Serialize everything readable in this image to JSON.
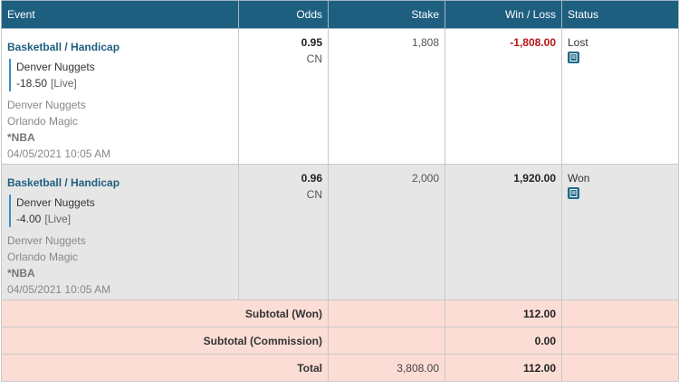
{
  "header": {
    "event": "Event",
    "odds": "Odds",
    "stake": "Stake",
    "winloss": "Win / Loss",
    "status": "Status"
  },
  "bets": [
    {
      "title": "Basketball / Handicap",
      "selection": "Denver Nuggets",
      "line": "-18.50",
      "live": "[Live]",
      "home": "Denver Nuggets",
      "away": "Orlando Magic",
      "league": "*NBA",
      "datetime": "04/05/2021 10:05 AM",
      "odds": "0.95",
      "odds_type": "CN",
      "stake": "1,808",
      "winloss": "-1,808.00",
      "status": "Lost",
      "status_icon": "receipt-icon"
    },
    {
      "title": "Basketball / Handicap",
      "selection": "Denver Nuggets",
      "line": "-4.00",
      "live": "[Live]",
      "home": "Denver Nuggets",
      "away": "Orlando Magic",
      "league": "*NBA",
      "datetime": "04/05/2021 10:05 AM",
      "odds": "0.96",
      "odds_type": "CN",
      "stake": "2,000",
      "winloss": "1,920.00",
      "status": "Won",
      "status_icon": "receipt-icon"
    }
  ],
  "summary": {
    "subtotal_won_label": "Subtotal (Won)",
    "subtotal_won_value": "112.00",
    "subtotal_commission_label": "Subtotal (Commission)",
    "subtotal_commission_value": "0.00",
    "total_label": "Total",
    "total_stake": "3,808.00",
    "total_value": "112.00"
  },
  "colors": {
    "header_bg": "#1e5f80",
    "loss": "#b31515",
    "summary_bg": "#fbddd5"
  }
}
